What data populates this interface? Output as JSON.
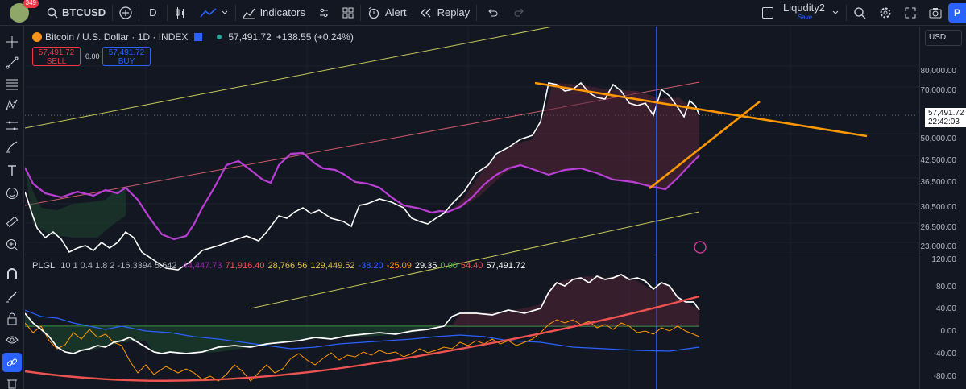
{
  "toolbar": {
    "notification_count": "349",
    "symbol": "BTCUSD",
    "interval": "D",
    "indicators_label": "Indicators",
    "alert_label": "Alert",
    "replay_label": "Replay",
    "layout_name": "Liqudity2",
    "layout_sub": "Save",
    "publish_label": "P"
  },
  "legend": {
    "title": "Bitcoin / U.S. Dollar · 1D · INDEX",
    "last": "57,491.72",
    "change": "+138.55 (+0.24%)",
    "sell_price": "57,491.72",
    "sell_label": "SELL",
    "buy_price": "57,491.72",
    "buy_label": "BUY",
    "spread": "0.00"
  },
  "indicator": {
    "name": "PLGL",
    "params": "10 1 0.4 1.8 2 -16.3394 5.642",
    "values": [
      {
        "text": "44,447.73",
        "color": "#9c27b0"
      },
      {
        "text": "71,916.40",
        "color": "#ef5350"
      },
      {
        "text": "28,766.56",
        "color": "#e0c34a"
      },
      {
        "text": "129,449.52",
        "color": "#e0c34a"
      },
      {
        "text": "-38.20",
        "color": "#2962ff"
      },
      {
        "text": "-25.09",
        "color": "#ff9800"
      },
      {
        "text": "29.35",
        "color": "#ffffff"
      },
      {
        "text": "0.00",
        "color": "#4caf50"
      },
      {
        "text": "54.40",
        "color": "#ef5350"
      },
      {
        "text": "57,491.72",
        "color": "#ffffff"
      }
    ]
  },
  "price_scale": {
    "currency": "USD",
    "main_ticks": [
      "80,000.00",
      "70,000.00",
      "50,000.00",
      "42,500.00",
      "36,500.00",
      "30,500.00",
      "26,500.00",
      "23,000.00"
    ],
    "current_price": "57,491.72",
    "countdown": "22:42:03",
    "indicator_ticks": [
      "120.00",
      "80.00",
      "40.00",
      "0.00",
      "-40.00",
      "-80.00"
    ]
  },
  "colors": {
    "background": "#131722",
    "price_line": "#ffffff",
    "ma_line": "#ba3fd4",
    "trendline": "#ff9800",
    "vertical_marker": "#2962ff",
    "channel_upper": "#c8c85a",
    "channel_mid": "#d05a6a"
  },
  "icons": {
    "left_toolbar": [
      "crosshair-icon",
      "trendline-icon",
      "fib-icon",
      "pattern-icon",
      "measure-icon",
      "brush-icon",
      "text-icon",
      "emoji-icon",
      "ruler-icon",
      "zoom-icon",
      "magnet-icon",
      "lock-icon",
      "eye-icon",
      "link-icon",
      "trash-icon"
    ]
  }
}
